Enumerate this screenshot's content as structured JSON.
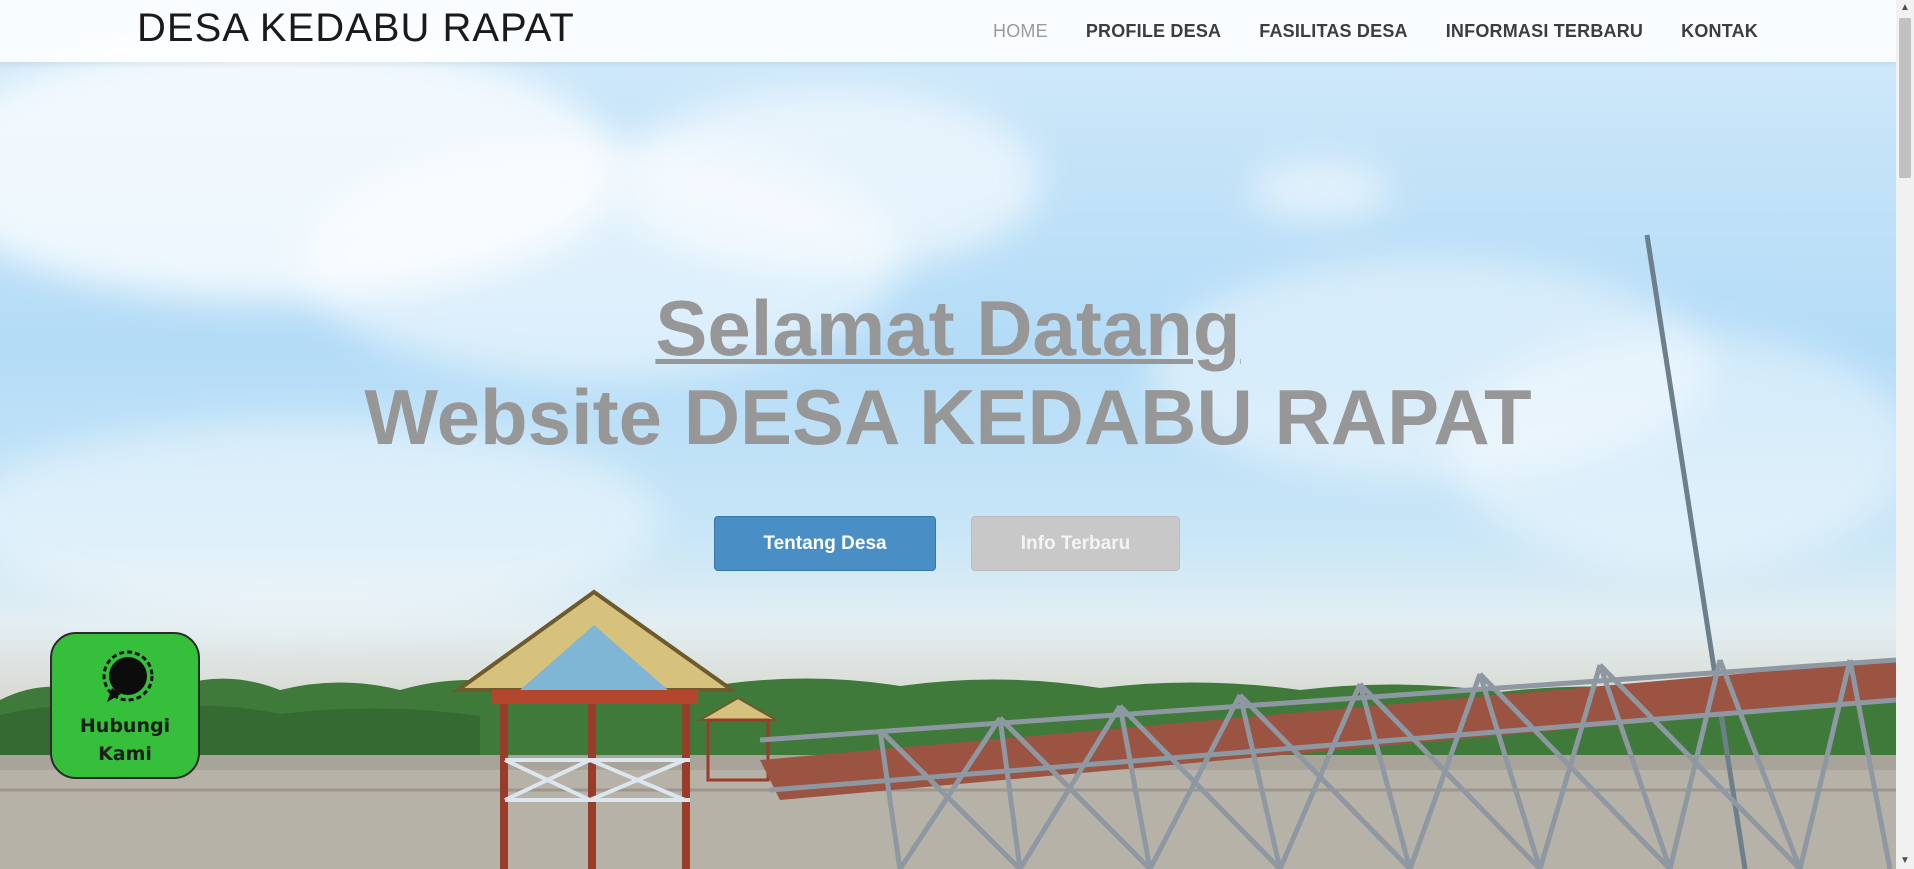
{
  "navbar": {
    "brand": "DESA KEDABU RAPAT",
    "items": [
      {
        "label": "HOME",
        "active": true
      },
      {
        "label": "PROFILE DESA",
        "active": false
      },
      {
        "label": "FASILITAS DESA",
        "active": false
      },
      {
        "label": "INFORMASI TERBARU",
        "active": false
      },
      {
        "label": "KONTAK",
        "active": false
      }
    ]
  },
  "hero": {
    "title_line1": "Selamat Datang",
    "title_line2": "Website DESA KEDABU RAPAT",
    "primary_button": "Tentang Desa",
    "secondary_button": "Info Terbaru"
  },
  "contact_widget": {
    "icon": "chat-bubble-icon",
    "label_line1": "Hubungi",
    "label_line2": "Kami"
  },
  "colors": {
    "primary_button": "#4a8ec6",
    "secondary_button": "#c8c8c8",
    "contact_widget": "#36bf3a",
    "hero_text": "#979797"
  }
}
